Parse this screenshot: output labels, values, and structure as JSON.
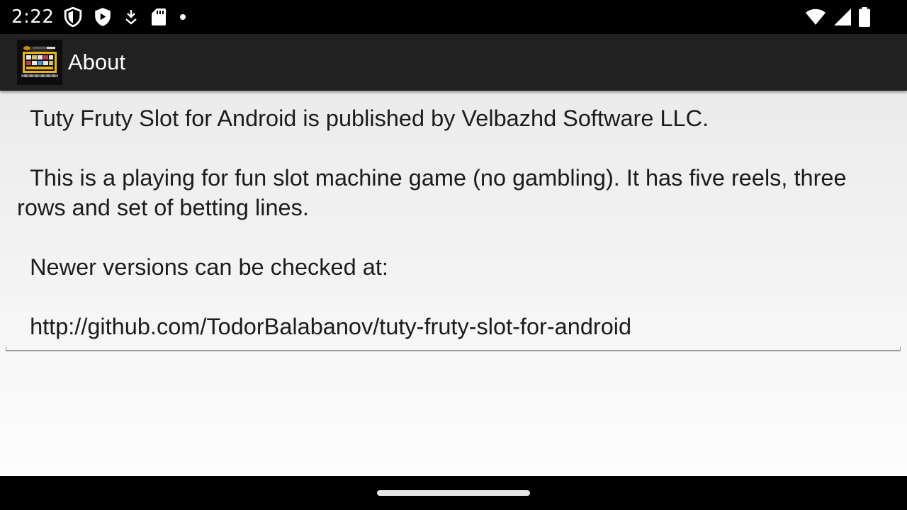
{
  "status_bar": {
    "time": "2:22",
    "left_icons": [
      "shield-outline-icon",
      "shield-filled-icon",
      "download-icon",
      "sd-card-icon",
      "notification-dot-icon"
    ],
    "right_icons": [
      "wifi-icon",
      "cellular-signal-icon",
      "battery-icon"
    ]
  },
  "app_bar": {
    "title": "About",
    "logo_icon": "casino-slot-logo"
  },
  "content": {
    "about_text": "  Tuty Fruty Slot for Android is published by Velbazhd Software LLC.\n\n  This is a playing for fun slot machine game (no gambling). It has five reels, three rows and set of betting lines.\n\n  Newer versions can be checked at:\n\n  http://github.com/TodorBalabanov/tuty-fruty-slot-for-android"
  },
  "colors": {
    "status_bar_bg": "#000000",
    "app_bar_bg": "#212121",
    "content_bg_top": "#ebebeb",
    "content_bg_bottom": "#fdfdfd",
    "text": "#1c1c1c"
  }
}
